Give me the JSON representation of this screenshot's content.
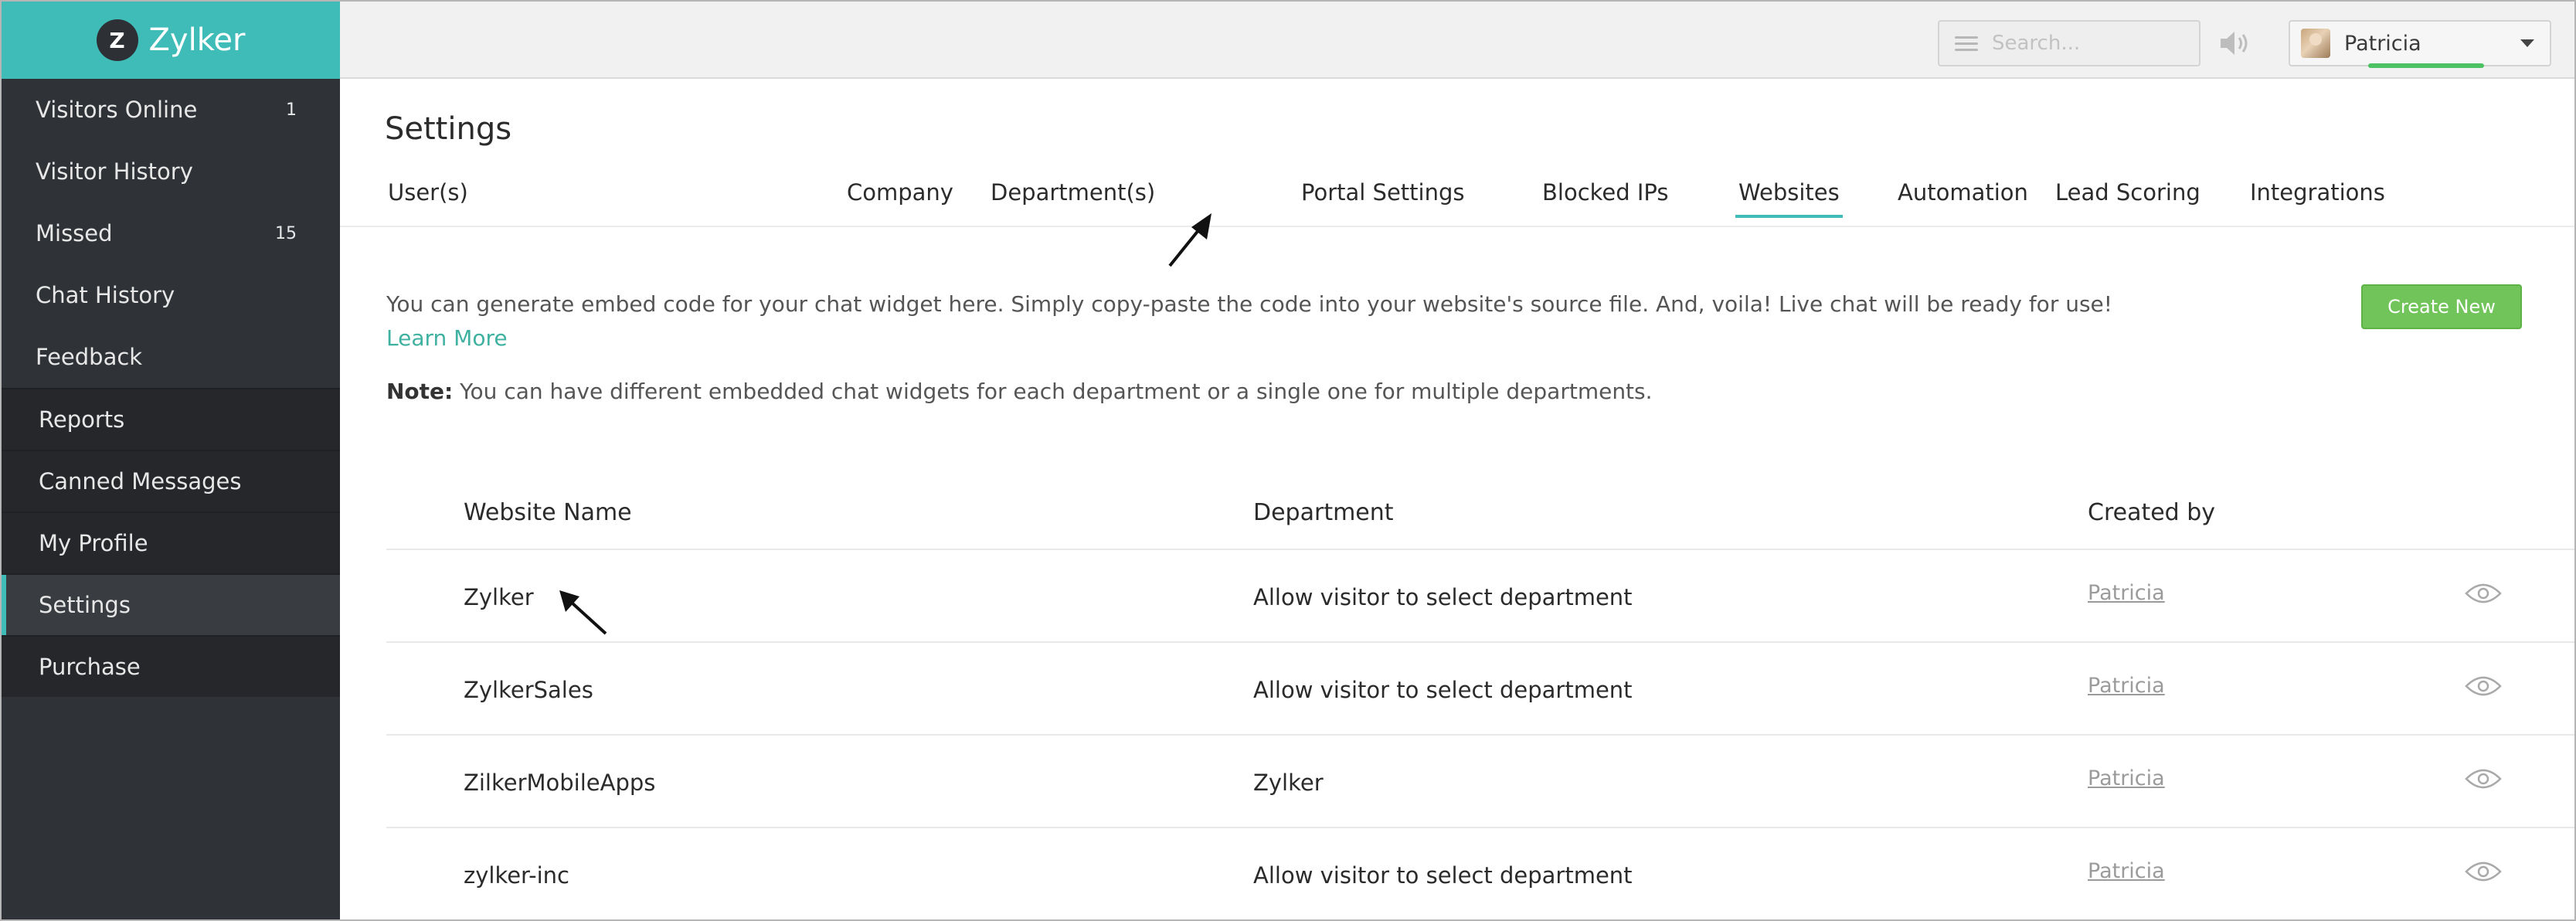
{
  "sidebar": {
    "logo_letter": "Z",
    "logo_text": "Zylker",
    "items": [
      {
        "label": "Visitors Online",
        "count": "1"
      },
      {
        "label": "Visitor History",
        "count": ""
      },
      {
        "label": "Missed",
        "count": "15"
      },
      {
        "label": "Chat History",
        "count": ""
      },
      {
        "label": "Feedback",
        "count": ""
      },
      {
        "label": "Reports",
        "count": ""
      },
      {
        "label": "Canned Messages",
        "count": ""
      },
      {
        "label": "My Profile",
        "count": ""
      },
      {
        "label": "Settings",
        "count": "",
        "active": true
      },
      {
        "label": "Purchase",
        "count": ""
      }
    ]
  },
  "topbar": {
    "search_placeholder": "Search...",
    "user_name": "Patricia"
  },
  "main": {
    "title": "Settings",
    "tabs": [
      "User(s)",
      "Company",
      "Department(s)",
      "Portal Settings",
      "Blocked IPs",
      "Websites",
      "Automation",
      "Lead Scoring",
      "Integrations"
    ],
    "active_tab": "Websites",
    "description": "You can generate embed code for your chat widget here. Simply copy-paste the code into your website's source file. And, voila! Live chat will be ready for use!",
    "learn_more": "Learn More",
    "note_label": "Note:",
    "note_text": " You can have different embedded chat widgets for each department or a single one for multiple departments.",
    "create_button": "Create New"
  },
  "table": {
    "headers": [
      "Website Name",
      "Department",
      "Created by"
    ],
    "rows": [
      {
        "name": "Zylker",
        "department": "Allow visitor to select department",
        "created_by": "Patricia"
      },
      {
        "name": "ZylkerSales",
        "department": "Allow visitor to select department",
        "created_by": "Patricia"
      },
      {
        "name": "ZilkerMobileApps",
        "department": "Zylker",
        "created_by": "Patricia"
      },
      {
        "name": "zylker-inc",
        "department": "Allow visitor to select department",
        "created_by": "Patricia"
      }
    ]
  },
  "colors": {
    "accent": "#3fbcb8",
    "sidebar_bg": "#2f3237",
    "create_button": "#70c459",
    "learn_more": "#3fb1a0"
  },
  "icons": {
    "menu": "hamburger-icon",
    "speaker": "speaker-icon",
    "view": "eye-icon",
    "dropdown": "chevron-down-icon"
  }
}
